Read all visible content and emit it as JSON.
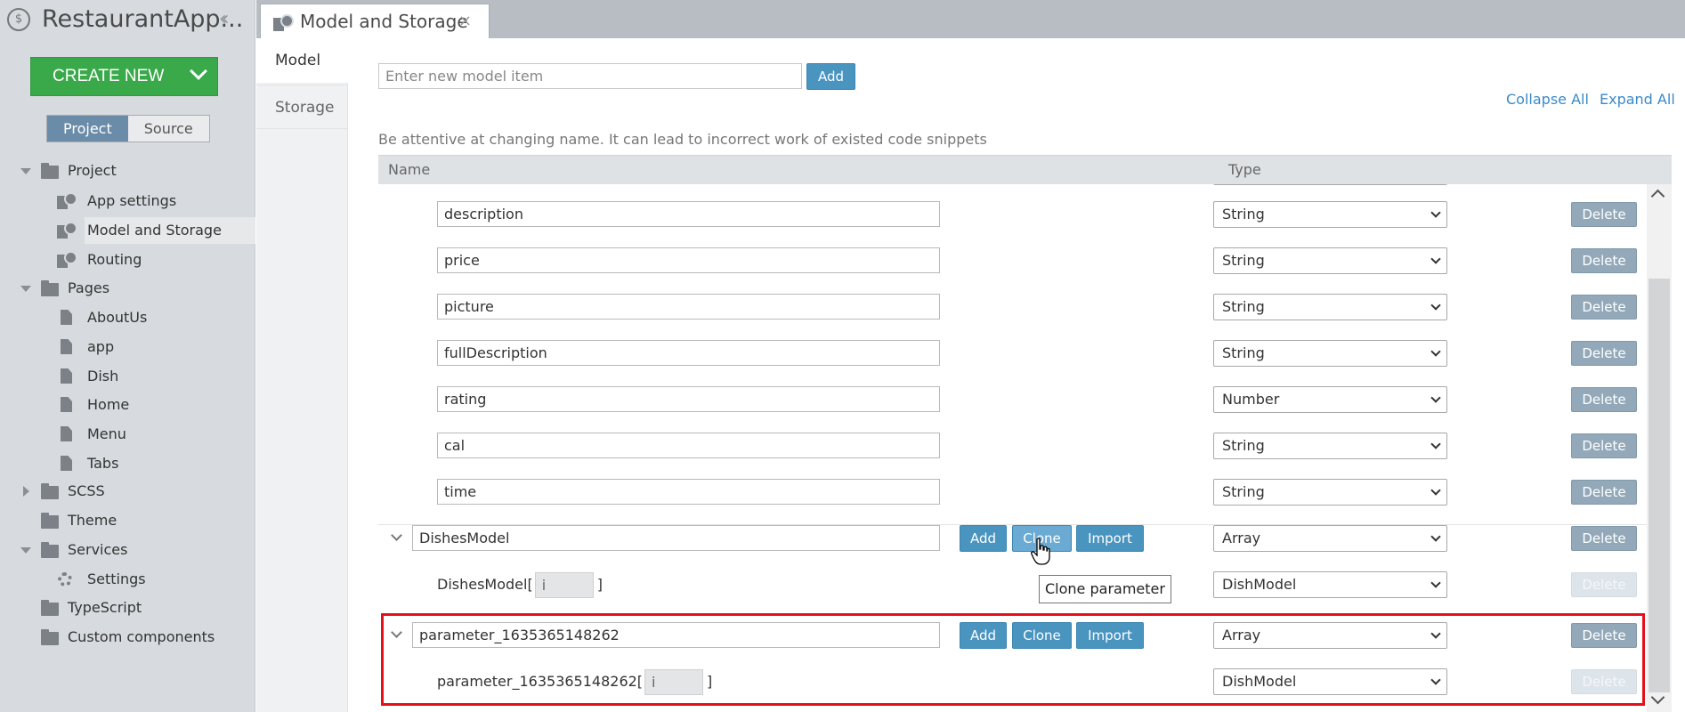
{
  "app": {
    "title": "RestaurantApp...",
    "create_new_label": "CREATE NEW"
  },
  "sidebar": {
    "toggle": {
      "project": "Project",
      "source": "Source"
    },
    "tree": [
      {
        "label": "Project",
        "kind": "folder",
        "expanded": true
      },
      {
        "label": "App settings",
        "kind": "settings-page"
      },
      {
        "label": "Model and Storage",
        "kind": "settings-page",
        "selected": true
      },
      {
        "label": "Routing",
        "kind": "settings-page"
      },
      {
        "label": "Pages",
        "kind": "folder",
        "expanded": true
      },
      {
        "label": "AboutUs",
        "kind": "page"
      },
      {
        "label": "app",
        "kind": "page"
      },
      {
        "label": "Dish",
        "kind": "page"
      },
      {
        "label": "Home",
        "kind": "page"
      },
      {
        "label": "Menu",
        "kind": "page"
      },
      {
        "label": "Tabs",
        "kind": "page"
      },
      {
        "label": "SCSS",
        "kind": "folder",
        "expanded": false
      },
      {
        "label": "Theme",
        "kind": "folder"
      },
      {
        "label": "Services",
        "kind": "folder",
        "expanded": true
      },
      {
        "label": "Settings",
        "kind": "gear"
      },
      {
        "label": "TypeScript",
        "kind": "folder"
      },
      {
        "label": "Custom components",
        "kind": "folder"
      }
    ]
  },
  "tab": {
    "label": "Model and Storage",
    "close": "×"
  },
  "inner_nav": {
    "model": "Model",
    "storage": "Storage"
  },
  "toolbar": {
    "new_item_placeholder": "Enter new model item",
    "add_label": "Add",
    "collapse_all": "Collapse All",
    "expand_all": "Expand All",
    "warning": "Be attentive at changing name. It can lead to incorrect work of existed code snippets"
  },
  "table": {
    "col_name": "Name",
    "col_type": "Type",
    "delete_label": "Delete",
    "add_label": "Add",
    "clone_label": "Clone",
    "import_label": "Import",
    "fields": [
      {
        "name": "description",
        "type": "String"
      },
      {
        "name": "price",
        "type": "String"
      },
      {
        "name": "picture",
        "type": "String"
      },
      {
        "name": "fullDescription",
        "type": "String"
      },
      {
        "name": "rating",
        "type": "Number"
      },
      {
        "name": "cal",
        "type": "String"
      },
      {
        "name": "time",
        "type": "String"
      }
    ],
    "dishes_model": {
      "name": "DishesModel",
      "type": "Array",
      "index_prefix": "DishesModel[",
      "index_value": "i",
      "index_suffix": "]",
      "item_type": "DishModel"
    },
    "parameter": {
      "name": "parameter_1635365148262",
      "type": "Array",
      "index_prefix": "parameter_1635365148262[",
      "index_value": "i",
      "index_suffix": "]",
      "item_type": "DishModel"
    }
  },
  "tooltip": "Clone parameter",
  "colors": {
    "accent": "#4a94c0",
    "create_new": "#3aa94a",
    "highlight": "#e5101a",
    "link": "#3a8ac8"
  }
}
